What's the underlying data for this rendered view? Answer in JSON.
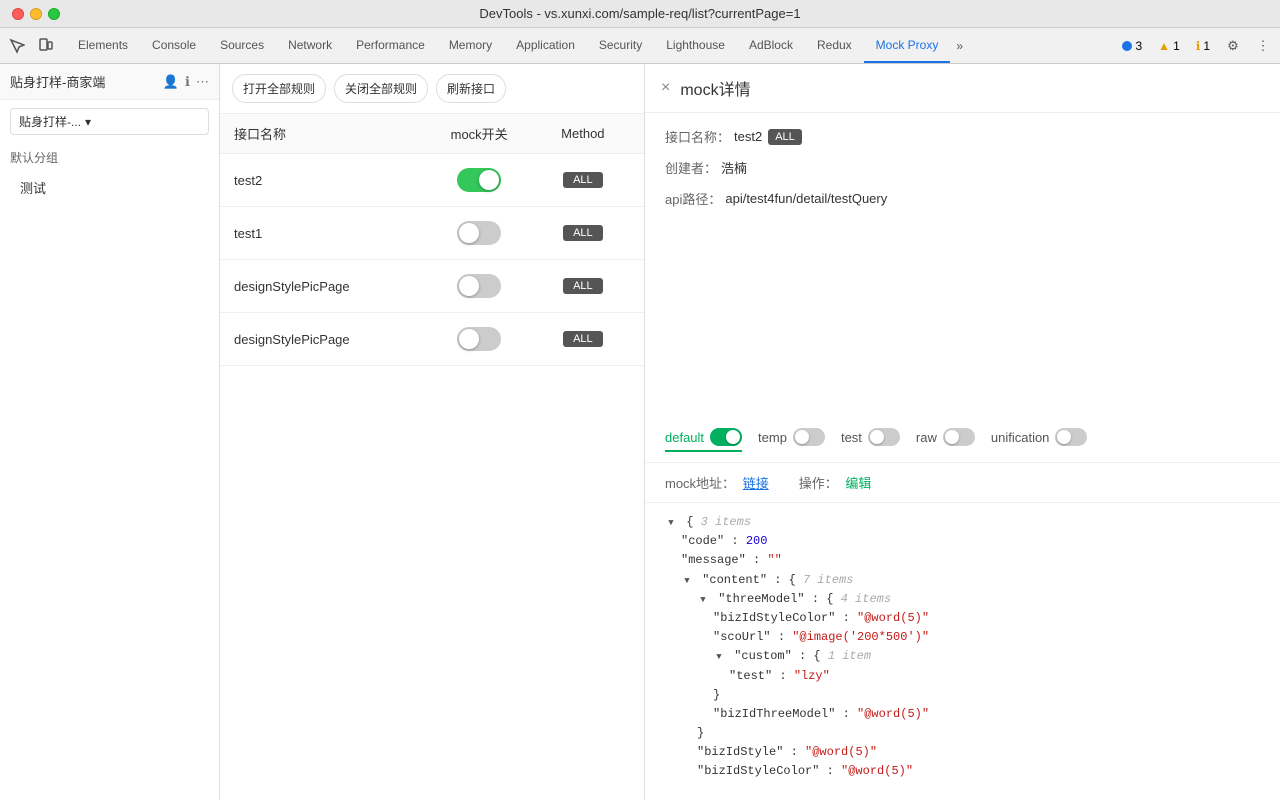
{
  "window": {
    "title": "DevTools - vs.xunxi.com/sample-req/list?currentPage=1"
  },
  "toolbar": {
    "tabs": [
      {
        "label": "Elements",
        "active": false
      },
      {
        "label": "Console",
        "active": false
      },
      {
        "label": "Sources",
        "active": false
      },
      {
        "label": "Network",
        "active": false
      },
      {
        "label": "Performance",
        "active": false
      },
      {
        "label": "Memory",
        "active": false
      },
      {
        "label": "Application",
        "active": false
      },
      {
        "label": "Security",
        "active": false
      },
      {
        "label": "Lighthouse",
        "active": false
      },
      {
        "label": "AdBlock",
        "active": false
      },
      {
        "label": "Redux",
        "active": false
      },
      {
        "label": "Mock Proxy",
        "active": true
      }
    ],
    "status": {
      "blue_count": "3",
      "triangle_count": "1",
      "yellow_count": "1"
    }
  },
  "left_panel": {
    "title": "贴身打样-商家端",
    "dropdown_label": "贴身打样-...",
    "sections": [
      {
        "label": "默认分组"
      },
      {
        "label": "测试"
      }
    ]
  },
  "action_buttons": {
    "open_all": "打开全部规则",
    "close_all": "关闭全部规则",
    "refresh": "刷新接口"
  },
  "table": {
    "headers": {
      "name": "接口名称",
      "mock": "mock开关",
      "method": "Method"
    },
    "rows": [
      {
        "name": "test2",
        "mock_on": true,
        "method": "ALL"
      },
      {
        "name": "test1",
        "mock_on": false,
        "method": "ALL"
      },
      {
        "name": "designStylePicPage",
        "mock_on": false,
        "method": "ALL"
      },
      {
        "name": "designStylePicPage",
        "mock_on": false,
        "method": "ALL"
      }
    ]
  },
  "detail": {
    "title": "mock详情",
    "close_label": "×",
    "interface_label": "接口名称：",
    "interface_name": "test2",
    "interface_badge": "ALL",
    "creator_label": "创建者：",
    "creator_name": "浩楠",
    "api_label": "api路径：",
    "api_path": "api/test4fun/detail/testQuery",
    "tabs": [
      {
        "label": "default",
        "active": true,
        "toggle_on": true
      },
      {
        "label": "temp",
        "active": false,
        "toggle_on": false
      },
      {
        "label": "test",
        "active": false,
        "toggle_on": false
      },
      {
        "label": "raw",
        "active": false,
        "toggle_on": false
      },
      {
        "label": "unification",
        "active": false,
        "toggle_on": false
      }
    ],
    "mock_address_label": "mock地址：",
    "mock_link_text": "链接",
    "operation_label": "操作：",
    "edit_label": "编辑",
    "json": {
      "root_comment": "3 items",
      "code_key": "\"code\"",
      "code_value": "200",
      "message_key": "\"message\"",
      "message_value": "\"\"",
      "content_key": "\"content\"",
      "content_comment": "7 items",
      "threeModel_key": "\"threeModel\"",
      "threeModel_comment": "4 items",
      "bizIdStyleColor_key": "\"bizIdStyleColor\"",
      "bizIdStyleColor_value": "\"@word(5)\"",
      "scoUrl_key": "\"scoUrl\"",
      "scoUrl_value": "\"@image('200*500')\"",
      "custom_key": "\"custom\"",
      "custom_comment": "1 item",
      "test_key": "\"test\"",
      "test_value": "\"lzy\"",
      "bizIdThreeModel_key": "\"bizIdThreeModel\"",
      "bizIdThreeModel_value": "\"@word(5)\"",
      "bizIdStyle_key": "\"bizIdStyle\"",
      "bizIdStyle_value": "\"@word(5)\"",
      "bizIdStyleColor2_key": "\"bizIdStyleColor\"",
      "bizIdStyleColor2_value": "\"@word(5)\""
    }
  }
}
